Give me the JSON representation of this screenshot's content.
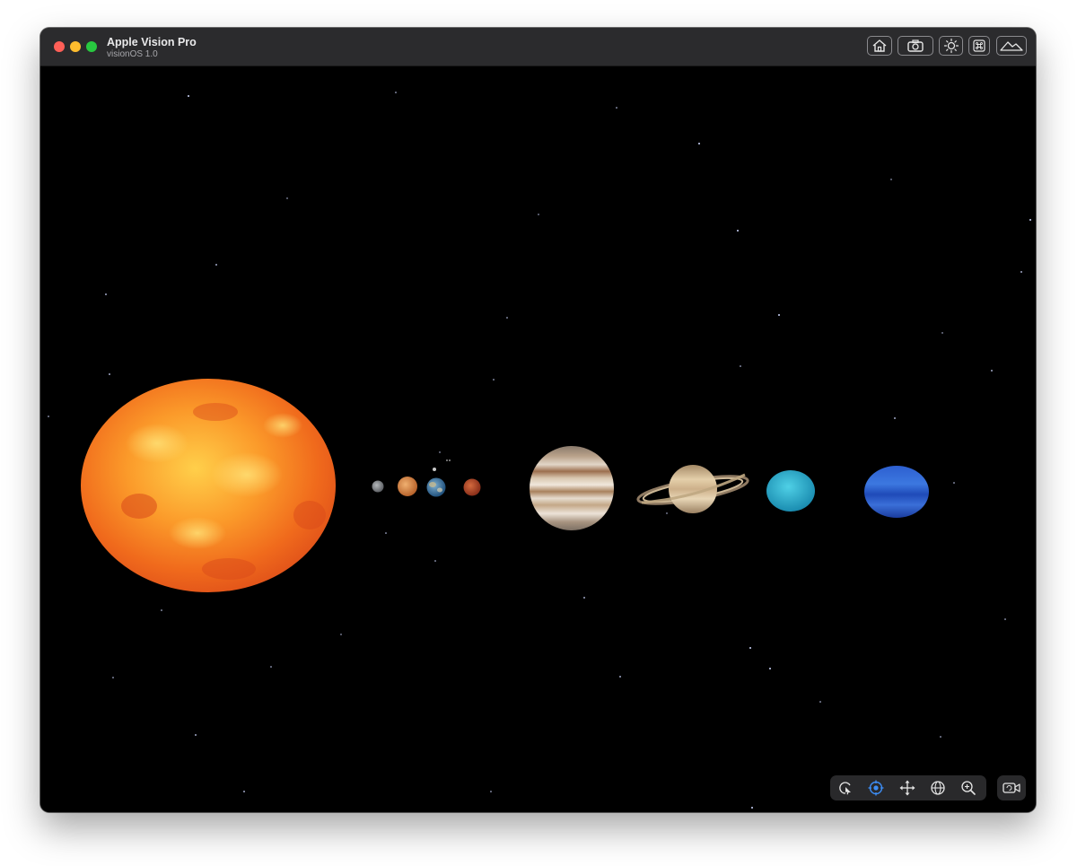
{
  "window": {
    "title": "Apple Vision Pro",
    "subtitle": "visionOS 1.0"
  },
  "titlebar_buttons": [
    {
      "name": "home-button",
      "icon": "home-icon"
    },
    {
      "name": "screenshot-button",
      "icon": "camera-icon"
    },
    {
      "name": "lighting-button",
      "icon": "sun-icon"
    },
    {
      "name": "keyboard-button",
      "icon": "command-icon"
    },
    {
      "name": "environment-button",
      "icon": "mountains-icon"
    }
  ],
  "scene": {
    "background": "#000000",
    "bodies": [
      {
        "name": "sun",
        "color": "#f4721c"
      },
      {
        "name": "mercury",
        "color": "#8f9295"
      },
      {
        "name": "venus",
        "color": "#d98c4a"
      },
      {
        "name": "earth",
        "color": "#3b78a8"
      },
      {
        "name": "mars",
        "color": "#b8472a"
      },
      {
        "name": "jupiter",
        "color": "#c9a987"
      },
      {
        "name": "saturn",
        "color": "#d6b88f"
      },
      {
        "name": "uranus",
        "color": "#2fb2d0"
      },
      {
        "name": "neptune",
        "color": "#2455c2"
      }
    ]
  },
  "bottom_toolbar": {
    "tools": [
      {
        "name": "tool-interact",
        "icon": "pointer-icon",
        "active": false
      },
      {
        "name": "tool-look",
        "icon": "crosshair-icon",
        "active": true
      },
      {
        "name": "tool-pan",
        "icon": "move-arrows-icon",
        "active": false
      },
      {
        "name": "tool-orbit",
        "icon": "orbit-icon",
        "active": false
      },
      {
        "name": "tool-zoom",
        "icon": "zoom-icon",
        "active": false
      }
    ],
    "record": {
      "name": "record-button",
      "icon": "video-camera-icon"
    },
    "accent_color": "#3d8df5"
  }
}
